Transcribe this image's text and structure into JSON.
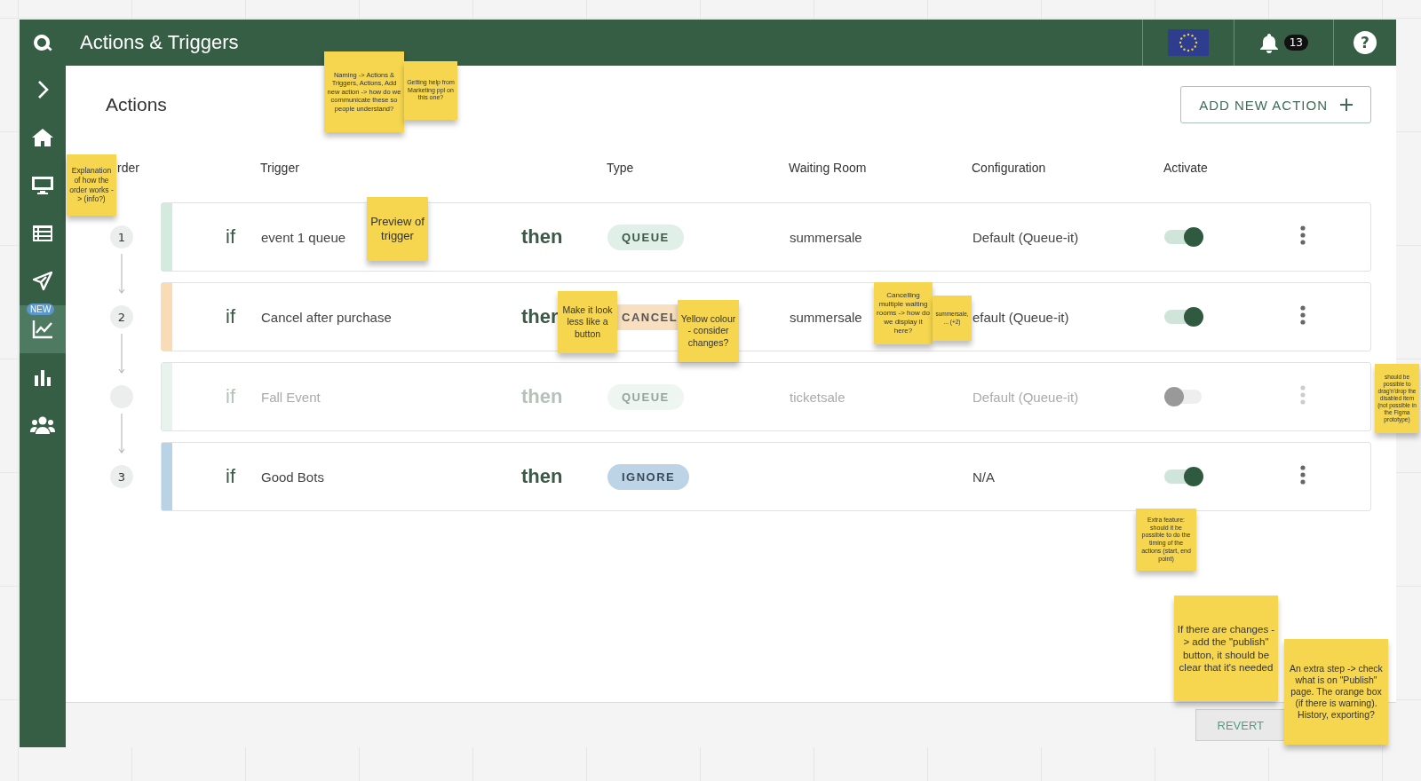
{
  "window": {
    "title": "Actions & Triggers"
  },
  "topbar": {
    "notifications": "13",
    "help": "?"
  },
  "sidebar": {
    "items": [
      {
        "selected": false
      },
      {
        "selected": false
      },
      {
        "selected": false
      },
      {
        "selected": false
      },
      {
        "selected": false
      },
      {
        "selected": true,
        "badge": "NEW"
      },
      {
        "selected": false
      },
      {
        "selected": false
      }
    ]
  },
  "page": {
    "heading": "Actions",
    "add_button": "ADD NEW ACTION"
  },
  "table": {
    "columns": [
      "rder",
      "Trigger",
      "Type",
      "Waiting Room",
      "Configuration",
      "Activate"
    ],
    "rows": [
      {
        "order": "1",
        "if": "if",
        "trigger": "event 1 queue",
        "then": "then",
        "type": {
          "label": "QUEUE",
          "kind": "queue"
        },
        "waiting_room": "summersale",
        "configuration": "Default (Queue-it)",
        "active": true,
        "disabled": false,
        "color": "#d4eadf"
      },
      {
        "order": "2",
        "if": "if",
        "trigger": "Cancel after purchase",
        "then": "ther",
        "type": {
          "label": "CANCEL",
          "kind": "cancel"
        },
        "waiting_room": "summersale",
        "configuration": "efault (Queue-it)",
        "active": true,
        "disabled": false,
        "color": "#f9dcb6"
      },
      {
        "if": "if",
        "trigger": "Fall Event",
        "then": "then",
        "type": {
          "label": "QUEUE",
          "kind": "queue"
        },
        "waiting_room": "ticketsale",
        "configuration": "Default (Queue-it)",
        "active": false,
        "disabled": true,
        "color": "#e8f3ed"
      },
      {
        "order": "3",
        "if": "if",
        "trigger": "Good Bots",
        "then": "then",
        "type": {
          "label": "IGNORE",
          "kind": "ignore"
        },
        "configuration": "N/A",
        "active": true,
        "disabled": false,
        "color": "#b9d2e5"
      }
    ]
  },
  "footer": {
    "revert_button": "REVERT"
  },
  "sticky_notes": [
    "Naming -> Actions & Triggers, Actions, Add new action -> how do we communicate these so people understand?",
    "Getting help from Marketing ppl on this one?",
    "Explanation of how the order works -> (info?)",
    "Preview of trigger",
    "Make it look less like a button",
    "Yellow colour - consider changes?",
    "Cancelling multiple waiting rooms -> how do we display it here?",
    "summersale, ... (+2)",
    "should be possible to drag'n'drop the disabled item (not possible in the Figma prototype)",
    "Extra feature: should it be possible to do the timing of the actions (start, end point)",
    "If there are changes -> add the \"publish\" button, it should be clear that it's needed",
    "An extra step -> check what is on \"Publish\" page. The orange box (if there is warning). History, exporting?"
  ]
}
